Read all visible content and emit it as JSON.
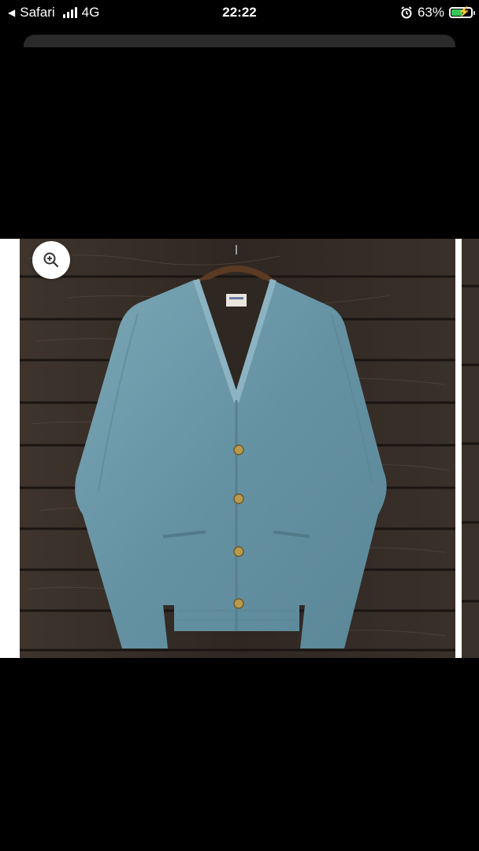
{
  "status_bar": {
    "back_app": "Safari",
    "network": "4G",
    "time": "22:22",
    "battery_percent": "63%",
    "battery_level": 0.63
  },
  "product_image": {
    "icons": {
      "zoom": "zoom-in-icon",
      "back": "back-arrow-icon",
      "alarm": "alarm-icon"
    },
    "colors": {
      "cardigan": "#6b96a6",
      "wood": "#362d27",
      "background": "#000000"
    }
  }
}
